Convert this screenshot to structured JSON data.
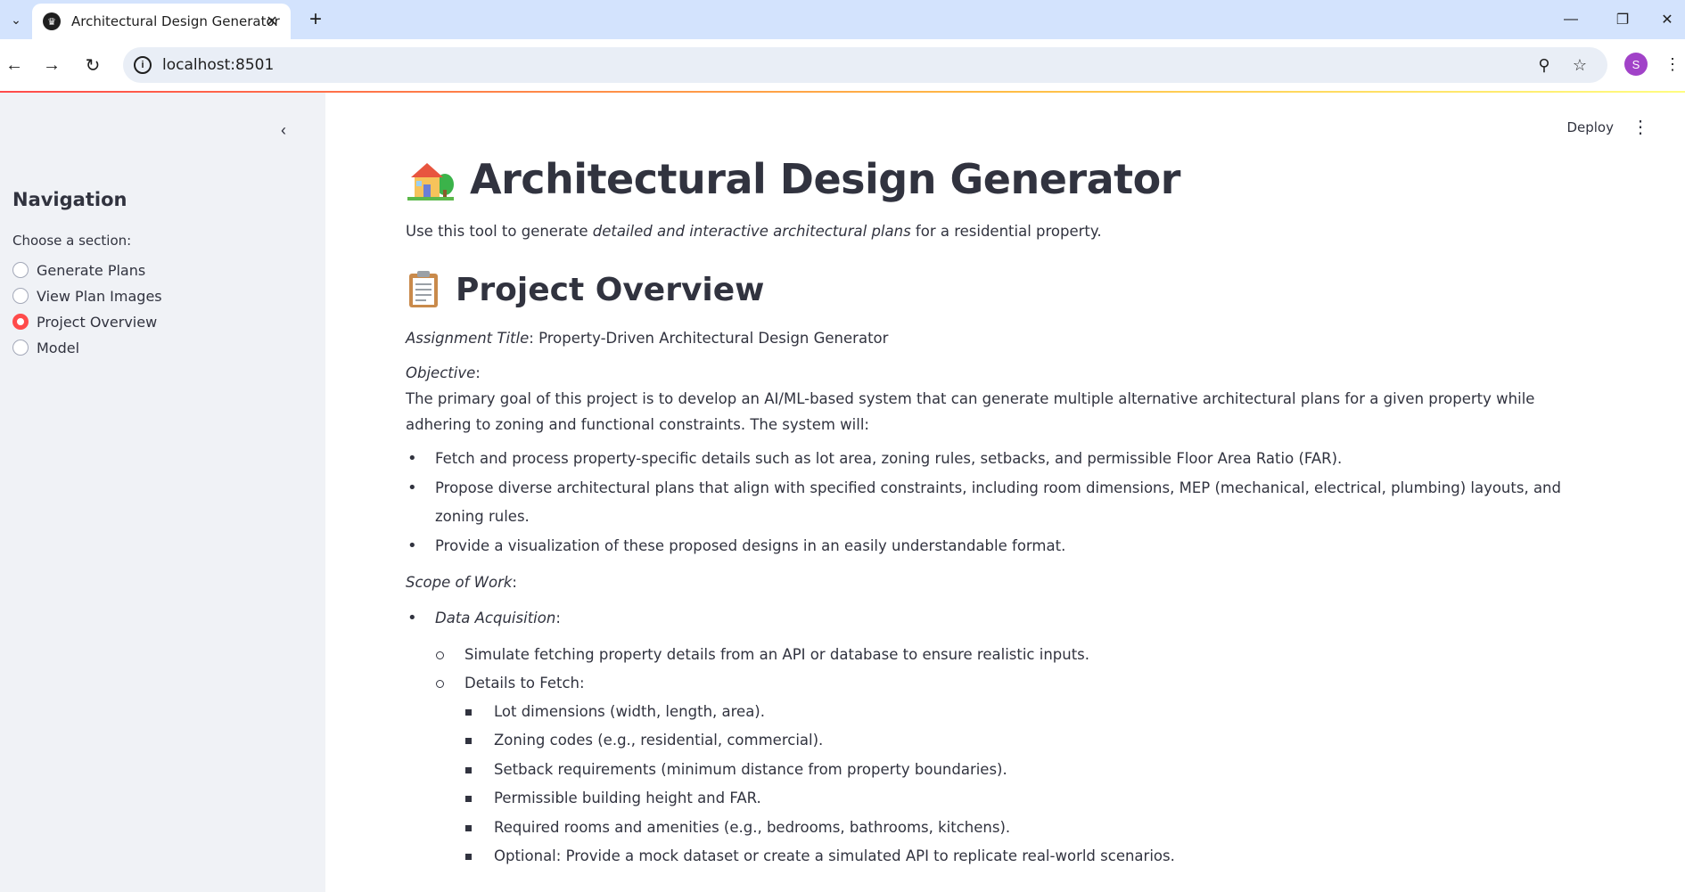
{
  "browser": {
    "tab_title": "Architectural Design Generator",
    "url": "localhost:8501",
    "profile_initial": "S"
  },
  "header": {
    "deploy_label": "Deploy"
  },
  "sidebar": {
    "title": "Navigation",
    "radio_label": "Choose a section:",
    "options": [
      {
        "label": "Generate Plans",
        "selected": false
      },
      {
        "label": "View Plan Images",
        "selected": false
      },
      {
        "label": "Project Overview",
        "selected": true
      },
      {
        "label": "Model",
        "selected": false
      }
    ]
  },
  "main": {
    "title": "Architectural Design Generator",
    "title_emoji": "house-with-garden-icon",
    "lead_prefix": "Use this tool to generate ",
    "lead_emphasis": "detailed and interactive architectural plans",
    "lead_suffix": " for a residential property.",
    "section_title": "Project Overview",
    "section_emoji": "clipboard-icon",
    "assignment_label": "Assignment Title",
    "assignment_value": ": Property-Driven Architectural Design Generator",
    "objective_label": "Objective",
    "objective_colon": ":",
    "objective_text": "The primary goal of this project is to develop an AI/ML-based system that can generate multiple alternative architectural plans for a given property while adhering to zoning and functional constraints. The system will:",
    "objective_bullets": [
      "Fetch and process property-specific details such as lot area, zoning rules, setbacks, and permissible Floor Area Ratio (FAR).",
      "Propose diverse architectural plans that align with specified constraints, including room dimensions, MEP (mechanical, electrical, plumbing) layouts, and zoning rules.",
      "Provide a visualization of these proposed designs in an easily understandable format."
    ],
    "scope_label": "Scope of Work",
    "scope_colon": ":",
    "data_acq_label": "Data Acquisition",
    "data_acq_colon": ":",
    "data_acq_items": [
      "Simulate fetching property details from an API or database to ensure realistic inputs.",
      "Details to Fetch:"
    ],
    "details_items": [
      "Lot dimensions (width, length, area).",
      "Zoning codes (e.g., residential, commercial).",
      "Setback requirements (minimum distance from property boundaries).",
      "Permissible building height and FAR.",
      "Required rooms and amenities (e.g., bedrooms, bathrooms, kitchens).",
      "Optional: Provide a mock dataset or create a simulated API to replicate real-world scenarios."
    ]
  }
}
